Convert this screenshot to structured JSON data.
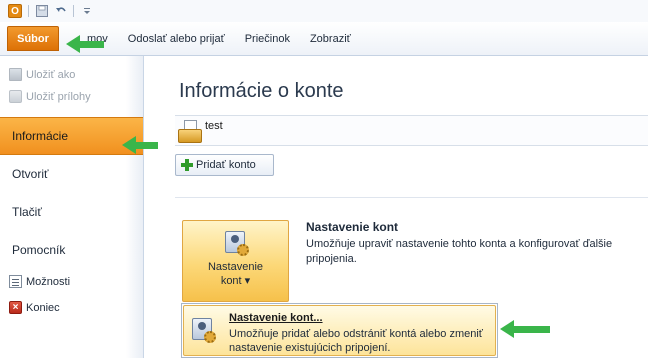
{
  "quick_access": {
    "app_icon": "outlook-icon",
    "icons": [
      "save-icon",
      "undo-icon",
      "customize-icon"
    ]
  },
  "ribbon": {
    "file_tab": "Súbor",
    "tabs": [
      "mov",
      "Odoslať alebo prijať",
      "Priečinok",
      "Zobraziť"
    ]
  },
  "nav": {
    "save_as": "Uložiť ako",
    "save_attachments": "Uložiť prílohy",
    "info": "Informácie",
    "open": "Otvoriť",
    "print": "Tlačiť",
    "help": "Pomocník",
    "options": "Možnosti",
    "exit": "Koniec"
  },
  "main": {
    "title": "Informácie o konte",
    "account_name": "test",
    "add_account": "Pridať konto",
    "settings_button_line1": "Nastavenie",
    "settings_button_line2": "kont ▾",
    "settings_title": "Nastavenie kont",
    "settings_desc": "Umožňuje upraviť nastavenie tohto konta a konfigurovať ďalšie pripojenia."
  },
  "dropdown": {
    "item_title": "Nastavenie kont...",
    "item_desc": "Umožňuje pridať alebo odstrániť kontá alebo zmeniť nastavenie existujúcich pripojení."
  },
  "colors": {
    "accent_orange": "#f1901f",
    "pointer_green": "#3ab54a",
    "highlight_yellow": "#fcd878"
  }
}
